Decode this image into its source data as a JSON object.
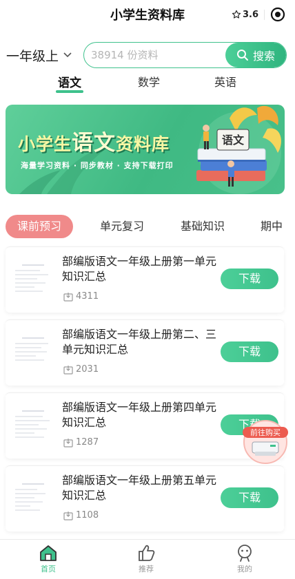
{
  "header": {
    "title": "小学生资料库",
    "rating": "3.6"
  },
  "grade": {
    "label": "一年级上"
  },
  "search": {
    "placeholder": "38914 份资料",
    "button_label": "搜索"
  },
  "subjects": [
    {
      "label": "语文",
      "active": true
    },
    {
      "label": "数学",
      "active": false
    },
    {
      "label": "英语",
      "active": false
    }
  ],
  "banner": {
    "title_part1": "小学生",
    "title_highlight": "语文",
    "title_part2": "资料库",
    "subtitle": "海量学习资料 · 同步教材 · 支持下载打印",
    "book_label": "语文"
  },
  "categories": [
    {
      "label": "课前预习",
      "active": true
    },
    {
      "label": "单元复习",
      "active": false
    },
    {
      "label": "基础知识",
      "active": false
    },
    {
      "label": "期中",
      "active": false
    }
  ],
  "documents": [
    {
      "title": "部编版语文一年级上册第一单元知识汇总",
      "downloads": "4311",
      "button": "下载"
    },
    {
      "title": "部编版语文一年级上册第二、三单元知识汇总",
      "downloads": "2031",
      "button": "下载"
    },
    {
      "title": "部编版语文一年级上册第四单元知识汇总",
      "downloads": "1287",
      "button": "下载"
    },
    {
      "title": "部编版语文一年级上册第五单元知识汇总",
      "downloads": "1108",
      "button": "下载"
    }
  ],
  "float_buy": {
    "label": "前往购买"
  },
  "bottom_nav": [
    {
      "label": "首页",
      "icon": "home-icon",
      "active": true
    },
    {
      "label": "推荐",
      "icon": "thumbs-up-icon",
      "active": false
    },
    {
      "label": "我的",
      "icon": "user-icon",
      "active": false
    }
  ],
  "colors": {
    "accent": "#3ec18c",
    "category_active": "#f08a8a",
    "banner_bg": "#4cc28e"
  }
}
